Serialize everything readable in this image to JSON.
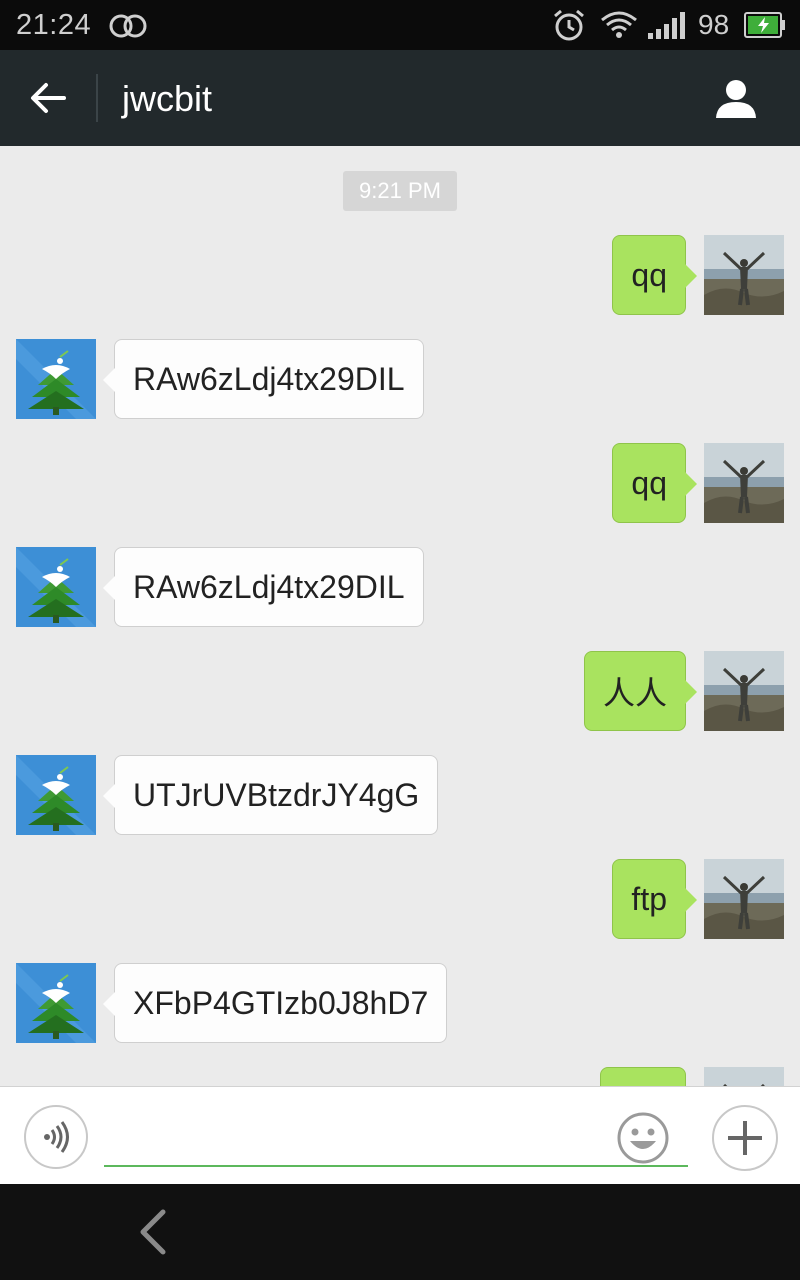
{
  "status_bar": {
    "time": "21:24",
    "battery_level": "98",
    "icons": [
      "dual-sim-icon",
      "alarm-icon",
      "wifi-icon",
      "signal-icon",
      "battery-charging-icon"
    ]
  },
  "title_bar": {
    "title": "jwcbit",
    "back_icon": "arrow-left-icon",
    "profile_icon": "person-icon"
  },
  "chat": {
    "timestamp": "9:21 PM",
    "messages": [
      {
        "direction": "out",
        "text": "qq"
      },
      {
        "direction": "in",
        "text": "RAw6zLdj4tx29DIL"
      },
      {
        "direction": "out",
        "text": "qq"
      },
      {
        "direction": "in",
        "text": "RAw6zLdj4tx29DIL"
      },
      {
        "direction": "out",
        "text": "人人"
      },
      {
        "direction": "in",
        "text": "UTJrUVBtzdrJY4gG"
      },
      {
        "direction": "out",
        "text": "ftp"
      },
      {
        "direction": "in",
        "text": "XFbP4GTIzb0J8hD7"
      },
      {
        "direction": "out",
        "text": ""
      }
    ]
  },
  "input_bar": {
    "text_value": "",
    "voice_icon": "voice-icon",
    "emoji_icon": "emoji-icon",
    "more_icon": "plus-icon"
  },
  "nav_bar": {
    "back_icon": "nav-back-icon"
  },
  "colors": {
    "outgoing_bubble": "#a9e35f",
    "incoming_bubble": "#fdfdfd",
    "title_bar": "#22292c",
    "chat_background": "#ebebeb",
    "input_underline": "#5cb85c"
  }
}
